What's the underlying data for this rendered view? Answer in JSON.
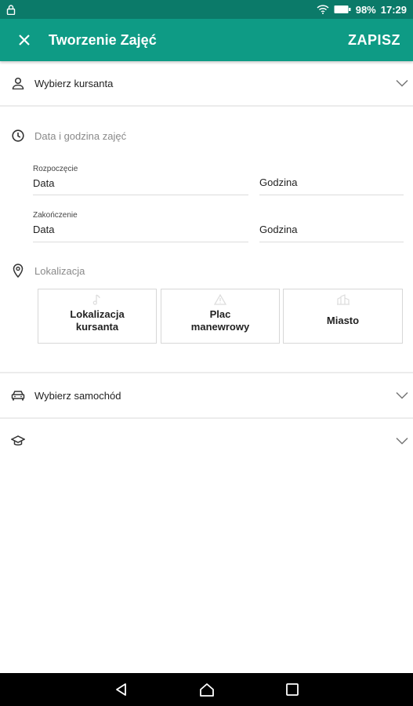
{
  "status": {
    "battery": "98%",
    "time": "17:29"
  },
  "appbar": {
    "title": "Tworzenie Zajęć",
    "save": "ZAPISZ"
  },
  "student": {
    "label": "Wybierz kursanta"
  },
  "datetime": {
    "label": "Data i godzina zajęć",
    "start": {
      "caption": "Rozpoczęcie",
      "date": "Data",
      "time": "Godzina"
    },
    "end": {
      "caption": "Zakończenie",
      "date": "Data",
      "time": "Godzina"
    }
  },
  "location": {
    "label": "Lokalizacja",
    "options": [
      {
        "line1": "Lokalizacja",
        "line2": "kursanta",
        "icon": "music-note-icon"
      },
      {
        "line1": "Plac",
        "line2": "manewrowy",
        "icon": "warning-triangle-icon"
      },
      {
        "line1": "Miasto",
        "line2": "",
        "icon": "city-icon"
      }
    ]
  },
  "car": {
    "label": "Wybierz samochód"
  },
  "category": {
    "label": ""
  },
  "colors": {
    "primary": "#0e9b85",
    "statusbar": "#0b7a69"
  }
}
